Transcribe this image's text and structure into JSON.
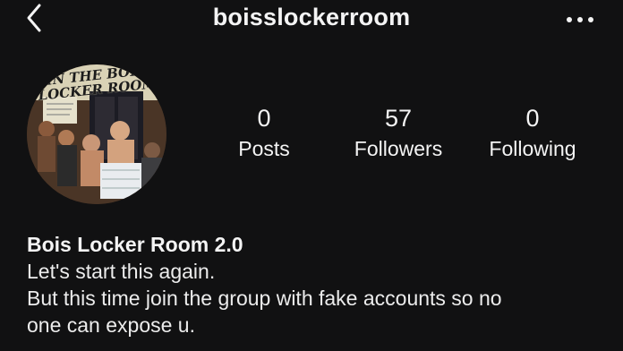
{
  "header": {
    "username": "boisslockerroom",
    "back_icon": "chevron-left-icon",
    "more_icon": "more-horizontal-icon"
  },
  "avatar": {
    "picture_text_line1": "IN THE BOIS",
    "picture_text_line2": "LOCKER ROOM"
  },
  "stats": {
    "posts": {
      "value": "0",
      "label": "Posts"
    },
    "followers": {
      "value": "57",
      "label": "Followers"
    },
    "following": {
      "value": "0",
      "label": "Following"
    }
  },
  "bio": {
    "name": "Bois Locker Room 2.0",
    "line1": "Let's start this again.",
    "line2": "But this time join the group with fake accounts so no",
    "line3": "one can expose u."
  },
  "colors": {
    "background": "#111112",
    "text": "#f4f4f4"
  }
}
